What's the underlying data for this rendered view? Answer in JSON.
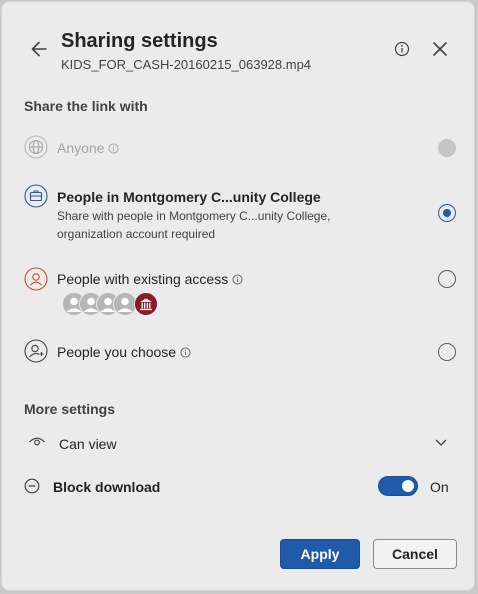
{
  "header": {
    "title": "Sharing settings",
    "filename": "KIDS_FOR_CASH-20160215_063928.mp4",
    "back_icon": "arrow-left-icon",
    "info_icon": "info-icon",
    "close_icon": "close-icon"
  },
  "share_section": {
    "heading": "Share the link with",
    "options": [
      {
        "label": "Anyone",
        "icon": "globe-icon",
        "has_info": true,
        "state": "disabled"
      },
      {
        "label": "People in Montgomery C...unity College",
        "description": "Share with people in Montgomery C...unity College, organization account required",
        "icon": "briefcase-icon",
        "state": "selected"
      },
      {
        "label": "People with existing access",
        "icon": "person-icon",
        "has_info": true,
        "state": "unselected",
        "avatars": [
          "person-avatar",
          "person-avatar",
          "person-avatar",
          "person-avatar",
          "institution-avatar"
        ]
      },
      {
        "label": "People you choose",
        "icon": "person-add-icon",
        "has_info": true,
        "state": "unselected"
      }
    ]
  },
  "more_settings": {
    "heading": "More settings",
    "permission": {
      "label": "Can view",
      "icon": "eye-icon",
      "dropdown_icon": "chevron-down-icon"
    },
    "block_download": {
      "label": "Block download",
      "icon": "block-icon",
      "toggle_state": "On",
      "enabled": true
    }
  },
  "footer": {
    "apply_label": "Apply",
    "cancel_label": "Cancel"
  },
  "colors": {
    "accent": "#1f5ba8",
    "avatar_institution": "#8b1a2b",
    "background": "#ebebeb"
  }
}
